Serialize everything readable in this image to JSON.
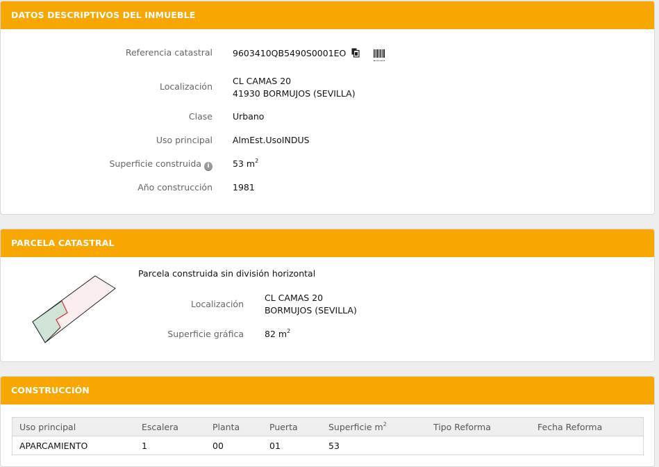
{
  "descriptivos": {
    "header": "DATOS DESCRIPTIVOS DEL INMUEBLE",
    "referencia_label": "Referencia catastral",
    "referencia_value": "9603410QB5490S0001EO",
    "copy_icon": "copy-icon",
    "barcode_icon": "barcode-icon",
    "localizacion_label": "Localización",
    "localizacion_line1": "CL CAMAS 20",
    "localizacion_line2": "41930 BORMUJOS (SEVILLA)",
    "clase_label": "Clase",
    "clase_value": "Urbano",
    "uso_label": "Uso principal",
    "uso_value": "AlmEst.UsoINDUS",
    "superficie_label": "Superficie construida",
    "info_icon": "info-icon",
    "superficie_value": "53 m",
    "superficie_unit_sup": "2",
    "anio_label": "Año construcción",
    "anio_value": "1981"
  },
  "parcela": {
    "header": "PARCELA CATASTRAL",
    "tipo": "Parcela construida sin división horizontal",
    "localizacion_label": "Localización",
    "localizacion_line1": "CL CAMAS 20",
    "localizacion_line2": "BORMUJOS (SEVILLA)",
    "superficie_label": "Superficie gráfica",
    "superficie_value": "82 m",
    "superficie_unit_sup": "2",
    "plot_icon": "parcel-map-icon"
  },
  "construccion": {
    "header": "CONSTRUCCIÓN",
    "columns": [
      "Uso principal",
      "Escalera",
      "Planta",
      "Puerta",
      "Superficie m",
      "Tipo Reforma",
      "Fecha Reforma"
    ],
    "superficie_col_sup": "2",
    "rows": [
      [
        "APARCAMIENTO",
        "1",
        "00",
        "01",
        "53",
        "",
        ""
      ]
    ]
  },
  "colors": {
    "header_bg": "#f8a700",
    "parcel_fill_green": "#cfe3d7",
    "parcel_fill_pink": "#fbeeee",
    "parcel_red_line": "#d43c3c"
  }
}
